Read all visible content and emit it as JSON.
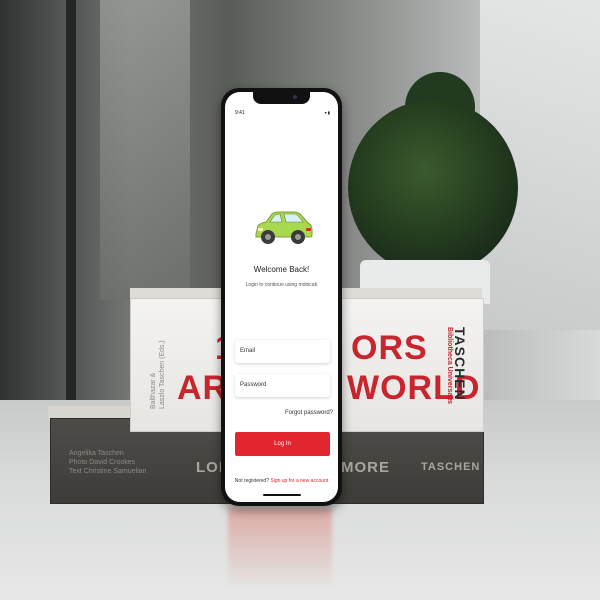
{
  "phone": {
    "status_bar": {
      "time": "9:41",
      "icons": "▾ ▮"
    },
    "welcome_title": "Welcome Back!",
    "subtitle": "Login to continue using mobicab",
    "email_placeholder": "Email",
    "password_placeholder": "Password",
    "forgot_password": "Forgot password?",
    "login_button": "Log In",
    "register_prompt": "Not registered?",
    "register_link": "Sign up for a new account",
    "accent_color": "#e2262f",
    "car_color": "#a7d94e",
    "car_icon": "car-icon"
  },
  "background": {
    "book_top_title_1": "1",
    "book_top_title_1b": "ORS",
    "book_top_title_2": "ARC",
    "book_top_title_2b": "WORLD",
    "book_top_spine": "TASCHEN",
    "book_top_spine_sub": "Bibliotheca Universalis",
    "book_top_authors": "Balthazar &\nLaszlo Taschen (Eds.)",
    "book_bottom_title_1": "LON",
    "book_bottom_title_2": "MORE",
    "book_bottom_brand": "TASCHEN",
    "book_bottom_authors": "Angelika Taschen\nPhoto David Crookes\nText Christine Samuelian"
  }
}
